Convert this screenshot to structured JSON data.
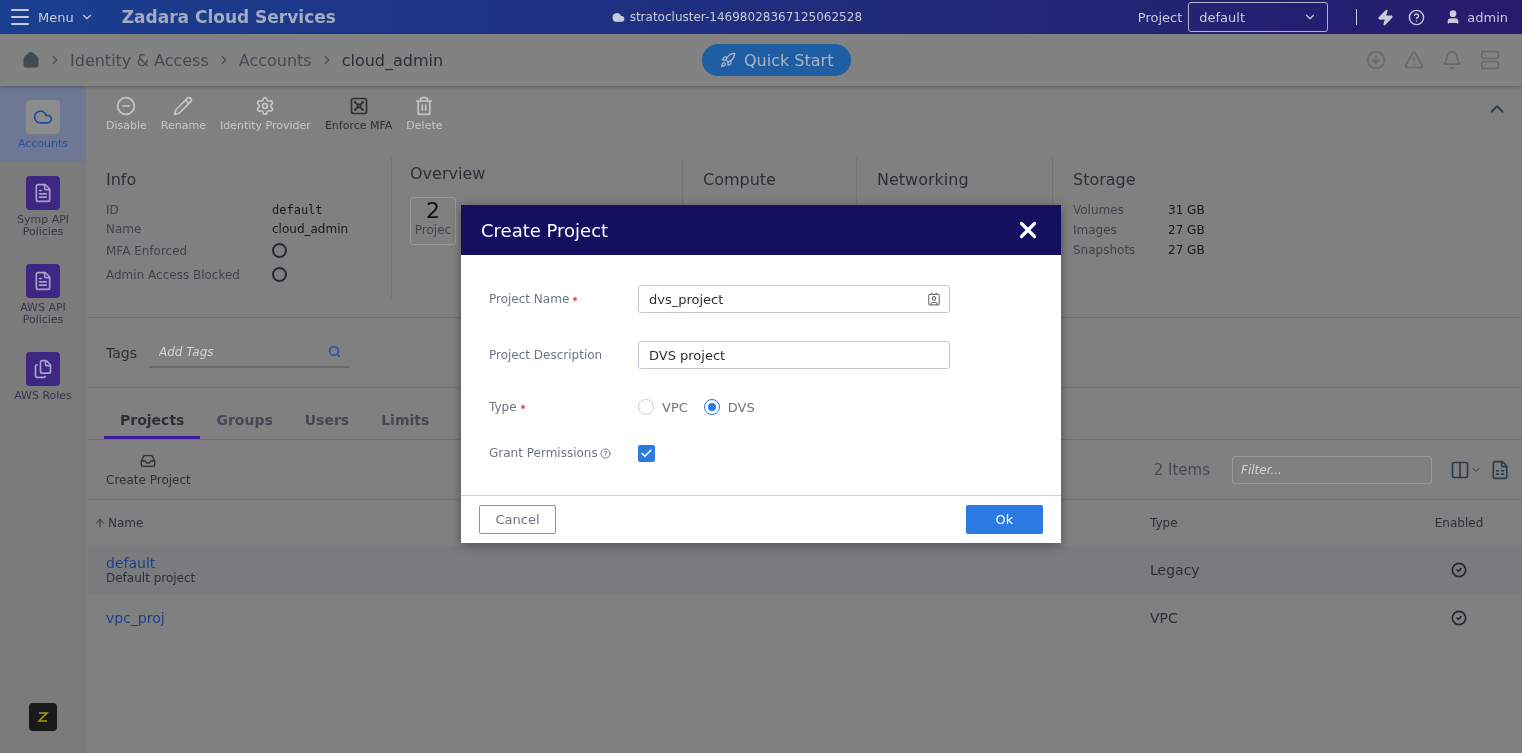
{
  "header": {
    "menu_label": "Menu",
    "title": "Zadara Cloud Services",
    "cluster": "stratocluster-14698028367125062528",
    "project_label": "Project",
    "project_select": "default",
    "user": "admin"
  },
  "breadcrumb": {
    "items": [
      "Identity & Access",
      "Accounts",
      "cloud_admin"
    ],
    "quick_start": "Quick Start"
  },
  "sidebar": {
    "items": [
      {
        "label": "Accounts",
        "selected": true
      },
      {
        "label": "Symp API Policies",
        "selected": false
      },
      {
        "label": "AWS API Policies",
        "selected": false
      },
      {
        "label": "AWS Roles",
        "selected": false
      }
    ]
  },
  "toolbar": {
    "actions": [
      {
        "label": "Disable",
        "disabled": true
      },
      {
        "label": "Rename",
        "disabled": true
      },
      {
        "label": "Identity Provider",
        "disabled": true
      },
      {
        "label": "Enforce MFA",
        "disabled": false
      },
      {
        "label": "Delete",
        "disabled": true
      }
    ]
  },
  "info": {
    "title": "Info",
    "rows": [
      {
        "label": "ID",
        "kind": "mono",
        "value": "default"
      },
      {
        "label": "Name",
        "kind": "text",
        "value": "cloud_admin"
      },
      {
        "label": "MFA Enforced",
        "kind": "flag",
        "checked": false
      },
      {
        "label": "Admin Access Blocked",
        "kind": "flag",
        "checked": false
      }
    ]
  },
  "overview": {
    "title": "Overview",
    "count": "2",
    "label": "Projec"
  },
  "compute": {
    "title": "Compute"
  },
  "networking": {
    "title": "Networking"
  },
  "storage": {
    "title": "Storage",
    "rows": [
      {
        "label": "Volumes",
        "value": "31 GB"
      },
      {
        "label": "Images",
        "value": "27 GB"
      },
      {
        "label": "Snapshots",
        "value": "27 GB"
      }
    ]
  },
  "tags": {
    "label": "Tags",
    "placeholder": "Add Tags"
  },
  "tabs": [
    {
      "label": "Projects",
      "selected": true
    },
    {
      "label": "Groups",
      "selected": false
    },
    {
      "label": "Users",
      "selected": false
    },
    {
      "label": "Limits",
      "selected": false
    }
  ],
  "list_toolbar": {
    "create": "Create Project",
    "count": "2 Items",
    "filter_placeholder": "Filter..."
  },
  "table": {
    "columns": [
      {
        "label": "Name",
        "sort_ascending": true
      },
      {
        "label": "Type"
      },
      {
        "label": "Enabled"
      }
    ],
    "rows": [
      {
        "name": "default",
        "description": "Default project",
        "type": "Legacy",
        "enabled": true
      },
      {
        "name": "vpc_proj",
        "type": "VPC",
        "enabled": true
      }
    ]
  },
  "dialog": {
    "title": "Create Project",
    "fields": [
      {
        "kind": "text",
        "label": "Project Name",
        "required": true,
        "value": "dvs_project"
      },
      {
        "kind": "text",
        "label": "Project Description",
        "required": false,
        "value": "DVS project"
      },
      {
        "kind": "radio",
        "label": "Type",
        "required": true,
        "options": [
          {
            "label": "VPC",
            "selected": false
          },
          {
            "label": "DVS",
            "selected": true
          }
        ]
      },
      {
        "kind": "checkbox",
        "label": "Grant Permissions",
        "required": false,
        "help": true,
        "checked": true
      }
    ],
    "buttons": [
      {
        "label": "Cancel",
        "kind": "secondary"
      },
      {
        "label": "Ok",
        "kind": "primary"
      }
    ]
  }
}
